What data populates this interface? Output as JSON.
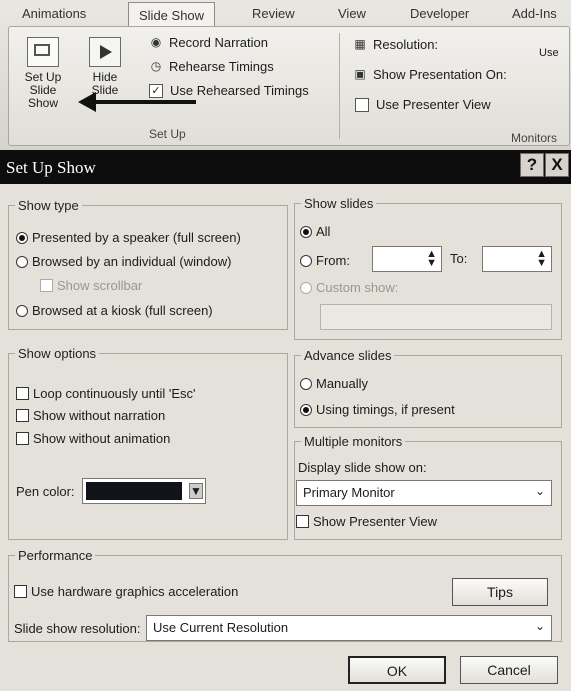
{
  "ribbon": {
    "tabs": [
      "Animations",
      "Slide Show",
      "Review",
      "View",
      "Developer",
      "Add-Ins"
    ],
    "setup_slide_show": "Set Up Slide Show",
    "hide_slide": "Hide Slide",
    "record_narration": "Record Narration",
    "rehearse_timings": "Rehearse Timings",
    "use_rehearsed_timings": "Use Rehearsed Timings",
    "group_setup": "Set Up",
    "resolution": "Resolution:",
    "resolution_value": "Use",
    "show_presentation_on": "Show Presentation On:",
    "use_presenter_view": "Use Presenter View",
    "group_monitors": "Monitors"
  },
  "dialog": {
    "title": "Set Up Show",
    "help": "?",
    "close": "X",
    "show_type": {
      "legend": "Show type",
      "presented": "Presented by a speaker (full screen)",
      "browsed_individual": "Browsed by an individual (window)",
      "show_scrollbar": "Show scrollbar",
      "browsed_kiosk": "Browsed at a kiosk (full screen)"
    },
    "show_slides": {
      "legend": "Show slides",
      "all": "All",
      "from": "From:",
      "from_value": "",
      "to": "To:",
      "to_value": "",
      "custom_show": "Custom show:"
    },
    "show_options": {
      "legend": "Show options",
      "loop": "Loop continuously until 'Esc'",
      "without_narration": "Show without narration",
      "without_animation": "Show without animation",
      "pen_color": "Pen color:",
      "pen_color_value": "#101418"
    },
    "advance_slides": {
      "legend": "Advance slides",
      "manually": "Manually",
      "using_timings": "Using timings, if present"
    },
    "multiple_monitors": {
      "legend": "Multiple monitors",
      "display_on": "Display slide show on:",
      "monitor": "Primary Monitor",
      "show_presenter_view": "Show Presenter View"
    },
    "performance": {
      "legend": "Performance",
      "hw_accel": "Use hardware graphics acceleration",
      "tips": "Tips",
      "resolution_label": "Slide show resolution:",
      "resolution_value": "Use Current Resolution"
    },
    "ok": "OK",
    "cancel": "Cancel"
  }
}
